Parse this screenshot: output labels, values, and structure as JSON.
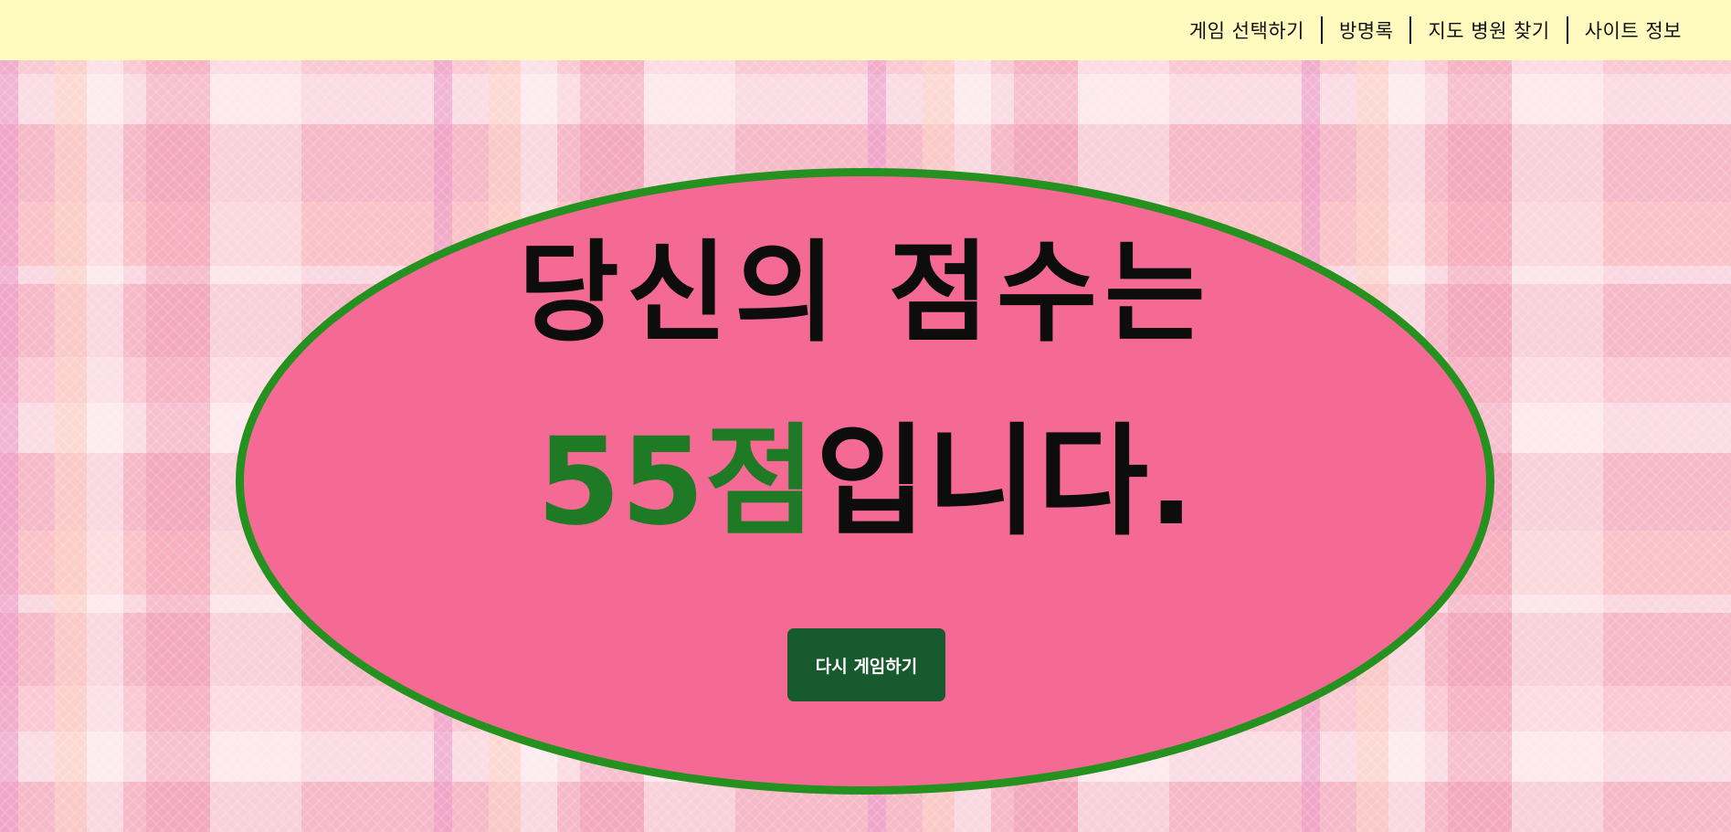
{
  "header": {
    "nav": [
      {
        "label": "게임 선택하기"
      },
      {
        "label": "방명록"
      },
      {
        "label": "지도 병원 찾기"
      },
      {
        "label": "사이트 정보"
      }
    ]
  },
  "result": {
    "line1": "당신의 점수는",
    "score": "55점",
    "line2_suffix": "입니다.",
    "replay_label": "다시 게임하기"
  },
  "colors": {
    "header_bg": "#fffbbf",
    "ellipse_fill": "#f56a95",
    "ellipse_border": "#25911f",
    "score_text": "#1f7a25",
    "button_bg": "#175a2e"
  }
}
